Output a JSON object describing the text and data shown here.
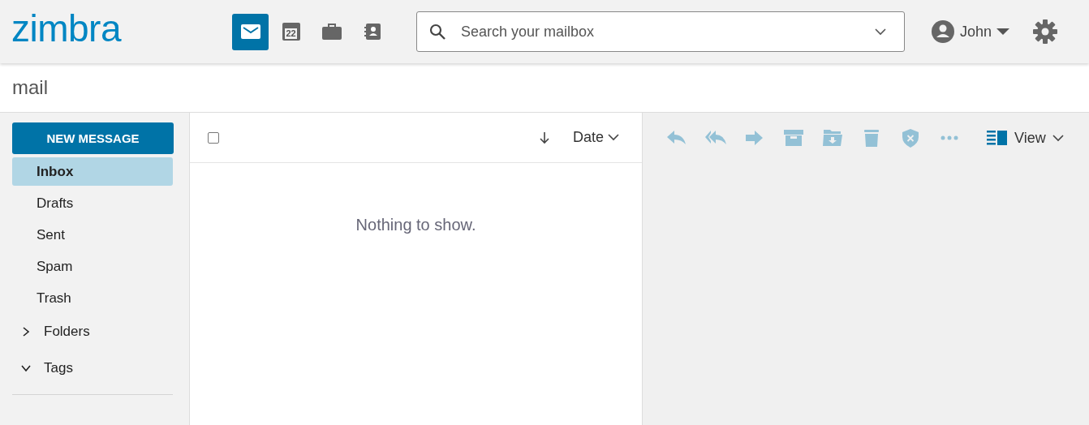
{
  "logo": "zimbra",
  "apps": [
    {
      "kind": "mail",
      "selected": true
    },
    {
      "kind": "calendar",
      "day": "22",
      "selected": false
    },
    {
      "kind": "briefcase",
      "selected": false
    },
    {
      "kind": "contacts",
      "selected": false
    }
  ],
  "search": {
    "placeholder": "Search your mailbox"
  },
  "user": {
    "name": "John"
  },
  "page_title": "mail",
  "new_message": "NEW MESSAGE",
  "folders": [
    {
      "label": "Inbox",
      "selected": true
    },
    {
      "label": "Drafts",
      "selected": false
    },
    {
      "label": "Sent",
      "selected": false
    },
    {
      "label": "Spam",
      "selected": false
    },
    {
      "label": "Trash",
      "selected": false
    }
  ],
  "sections": [
    {
      "label": "Folders",
      "expanded": false
    },
    {
      "label": "Tags",
      "expanded": true
    }
  ],
  "list": {
    "select_all": false,
    "sort_label": "Date",
    "empty_text": "Nothing to show."
  },
  "actions": [
    {
      "kind": "reply",
      "disabled": true
    },
    {
      "kind": "reply-all",
      "disabled": true
    },
    {
      "kind": "forward",
      "disabled": true
    },
    {
      "kind": "archive",
      "disabled": true
    },
    {
      "kind": "move",
      "disabled": true
    },
    {
      "kind": "delete",
      "disabled": true
    },
    {
      "kind": "spam",
      "disabled": true
    },
    {
      "kind": "more",
      "disabled": true
    }
  ],
  "view_label": "View"
}
